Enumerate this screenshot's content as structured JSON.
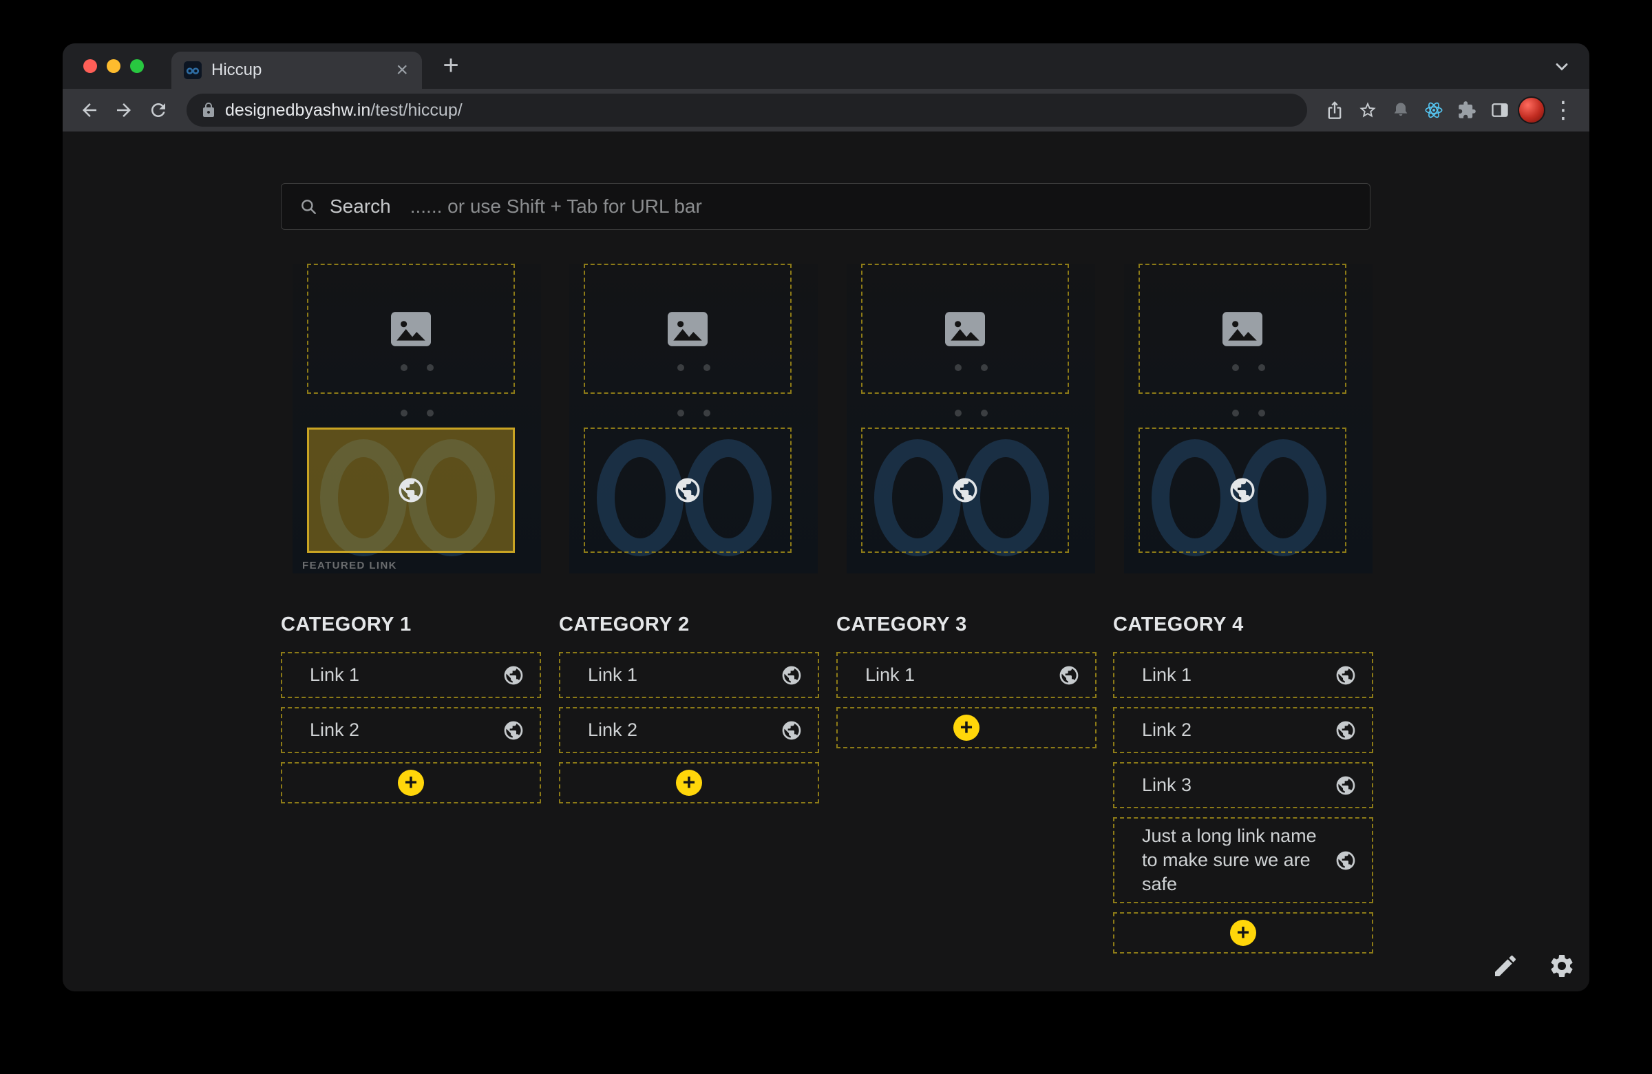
{
  "browser": {
    "tab_title": "Hiccup",
    "url": {
      "domain": "designedbyashw.in",
      "path": "/test/hiccup/",
      "full": "designedbyashw.in/test/hiccup/"
    }
  },
  "glyphs": {
    "close_tab": "×",
    "new_tab": "+",
    "menu": "⋮",
    "plus": "+"
  },
  "icons": {
    "traffic_close": "red-dot",
    "traffic_minimize": "yellow-dot",
    "traffic_zoom": "green-dot",
    "favicon": "hiccup-logo-two-blue-circles",
    "tab_search": "chevron-down",
    "back": "left-arrow",
    "forward": "right-arrow",
    "refresh": "reload-arrow",
    "lock": "padlock",
    "share": "export-arrow",
    "bookmark": "star-outline",
    "extension_1": "bell",
    "extension_2": "atom",
    "extensions": "puzzle-piece",
    "side_panel": "split-rectangle",
    "profile": "avatar",
    "search": "magnifier",
    "image_placeholder": "picture-frame",
    "link_globe": "globe",
    "add": "plus-circle",
    "edit": "pencil",
    "settings": "gear"
  },
  "search": {
    "label": "Search",
    "hint": "...... or use Shift + Tab for URL bar"
  },
  "featured": {
    "captions": [
      "FEATURED LINK",
      "",
      "",
      ""
    ]
  },
  "categories": [
    {
      "title": "CATEGORY 1",
      "links": [
        "Link 1",
        "Link 2"
      ]
    },
    {
      "title": "CATEGORY 2",
      "links": [
        "Link 1",
        "Link 2"
      ]
    },
    {
      "title": "CATEGORY 3",
      "links": [
        "Link 1"
      ]
    },
    {
      "title": "CATEGORY 4",
      "links": [
        "Link 1",
        "Link 2",
        "Link 3",
        "Just a long link name to make sure we are safe"
      ]
    }
  ],
  "colors": {
    "accent": "#ffd60a",
    "dashed_border": "#8d7b17",
    "selected_border": "#c9a423",
    "selected_fill": "rgba(199,163,31,0.42)",
    "page_bg": "#151516",
    "toolbar_bg": "#35363a",
    "frame_bg": "#202124"
  }
}
